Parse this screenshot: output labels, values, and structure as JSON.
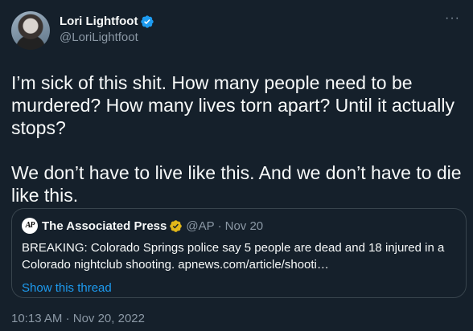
{
  "author": {
    "display_name": "Lori Lightfoot",
    "handle": "@LoriLightfoot"
  },
  "tweet": {
    "text": "I’m sick of this shit. How many people need to be murdered? How many lives torn apart? Until it actually stops?\n\nWe don’t have to live like this. And we don’t have to die like this.",
    "time": "10:13 AM",
    "separator": "·",
    "date": "Nov 20, 2022"
  },
  "quoted": {
    "logo_text": "AP",
    "display_name": "The Associated Press",
    "handle": "@AP",
    "separator": "·",
    "date": "Nov 20",
    "text": "BREAKING: Colorado Springs police say 5 people are dead and 18 injured in a Colorado nightclub shooting. apnews.com/article/shooti…",
    "thread_link": "Show this thread"
  },
  "more_menu": "···",
  "colors": {
    "background": "#15202b",
    "text_primary": "#f7f9f9",
    "text_secondary": "#8b98a5",
    "link": "#1d9bf0",
    "verified_blue": "#1d9bf0",
    "verified_gold": "#e2b719",
    "border": "#38444d"
  },
  "icons": {
    "verified": "verified-badge-icon",
    "org_verified": "gold-verified-badge-icon",
    "more": "more-options-icon"
  }
}
